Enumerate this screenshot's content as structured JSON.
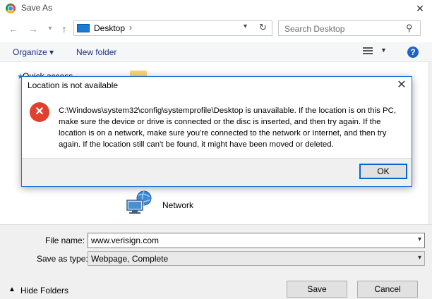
{
  "window": {
    "title": "Save As",
    "close_glyph": "✕"
  },
  "nav": {
    "back_icon": "arrow-left-icon",
    "forward_icon": "arrow-right-icon",
    "up_icon": "arrow-up-icon"
  },
  "address": {
    "location": "Desktop",
    "chevron": "›"
  },
  "search": {
    "placeholder": "Search Desktop"
  },
  "toolbar": {
    "organize_label": "Organize ▾",
    "new_folder_label": "New folder",
    "help_glyph": "?"
  },
  "left_pane": {
    "partial_item": "Quick access"
  },
  "content": {
    "network_label": "Network"
  },
  "form": {
    "file_name_label": "File name:",
    "file_name_value": "www.verisign.com",
    "save_as_type_label": "Save as type:",
    "save_as_type_value": "Webpage, Complete"
  },
  "footer": {
    "hide_folders_label": "Hide Folders",
    "save_label": "Save",
    "cancel_label": "Cancel"
  },
  "dialog": {
    "title": "Location is not available",
    "close_glyph": "✕",
    "message": "C:\\Windows\\system32\\config\\systemprofile\\Desktop is unavailable. If the location is on this PC, make sure the device or drive is connected or the disc is inserted, and then try again. If the location is on a network, make sure you're connected to the network or Internet, and then try again. If the location still can't be found, it might have been moved or deleted.",
    "ok_label": "OK",
    "icon": "error-icon"
  }
}
